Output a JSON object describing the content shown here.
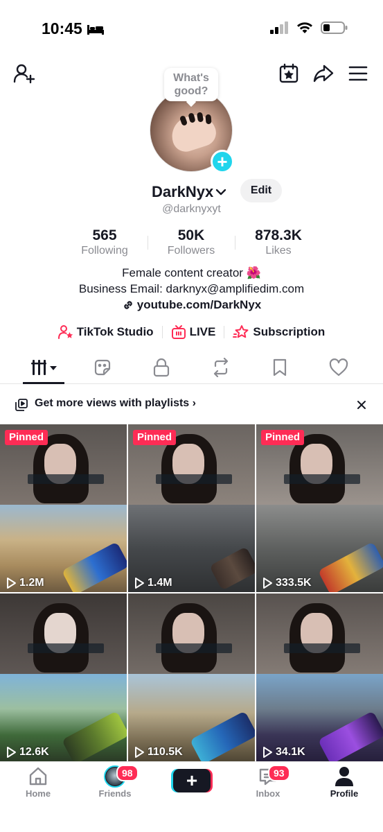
{
  "status_bar": {
    "time": "10:45"
  },
  "bubble": {
    "text": "What's good?"
  },
  "profile": {
    "display_name": "DarkNyx",
    "edit_label": "Edit",
    "handle": "@darknyxyt"
  },
  "stats": [
    {
      "value": "565",
      "label": "Following"
    },
    {
      "value": "50K",
      "label": "Followers"
    },
    {
      "value": "878.3K",
      "label": "Likes"
    }
  ],
  "bio": {
    "line1": "Female content creator 🌺",
    "line2": "Business Email: darknyx@amplifiedim.com",
    "link": "youtube.com/DarkNyx"
  },
  "tools": {
    "studio": "TikTok Studio",
    "live": "LIVE",
    "subscription": "Subscription"
  },
  "playlist_banner": {
    "text": "Get more views with playlists"
  },
  "videos": [
    {
      "pinned_label": "Pinned",
      "views": "1.2M"
    },
    {
      "pinned_label": "Pinned",
      "views": "1.4M"
    },
    {
      "pinned_label": "Pinned",
      "views": "333.5K"
    },
    {
      "pinned_label": "",
      "views": "12.6K"
    },
    {
      "pinned_label": "",
      "views": "110.5K"
    },
    {
      "pinned_label": "",
      "views": "34.1K"
    }
  ],
  "bottom_nav": {
    "home": "Home",
    "friends": "Friends",
    "friends_badge": "98",
    "create": "+",
    "inbox": "Inbox",
    "inbox_badge": "93",
    "profile": "Profile"
  },
  "colors": {
    "accent_red": "#fe2c55",
    "accent_cyan": "#20d5ec",
    "text_primary": "#161823",
    "text_secondary": "#8a8b91"
  }
}
